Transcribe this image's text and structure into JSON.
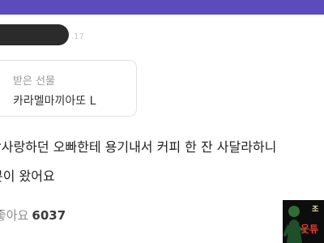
{
  "colors": {
    "top_bar": "#5b4bbd",
    "redaction": "#2b2b2b",
    "watermark_accent": "#e23b2e"
  },
  "message": {
    "date_partial": ".17",
    "gift": {
      "label": "받은 선물",
      "item_name": "카라멜마끼아또 L"
    }
  },
  "post": {
    "line1": "짝사랑하던 오빠한테 용기내서 커피 한 잔 사달라하니",
    "line2": "콘이 왔어요"
  },
  "likes": {
    "label": "좋아요",
    "count": "6037"
  },
  "watermark": {
    "top_text": "조",
    "bottom_text": "웃튜"
  }
}
